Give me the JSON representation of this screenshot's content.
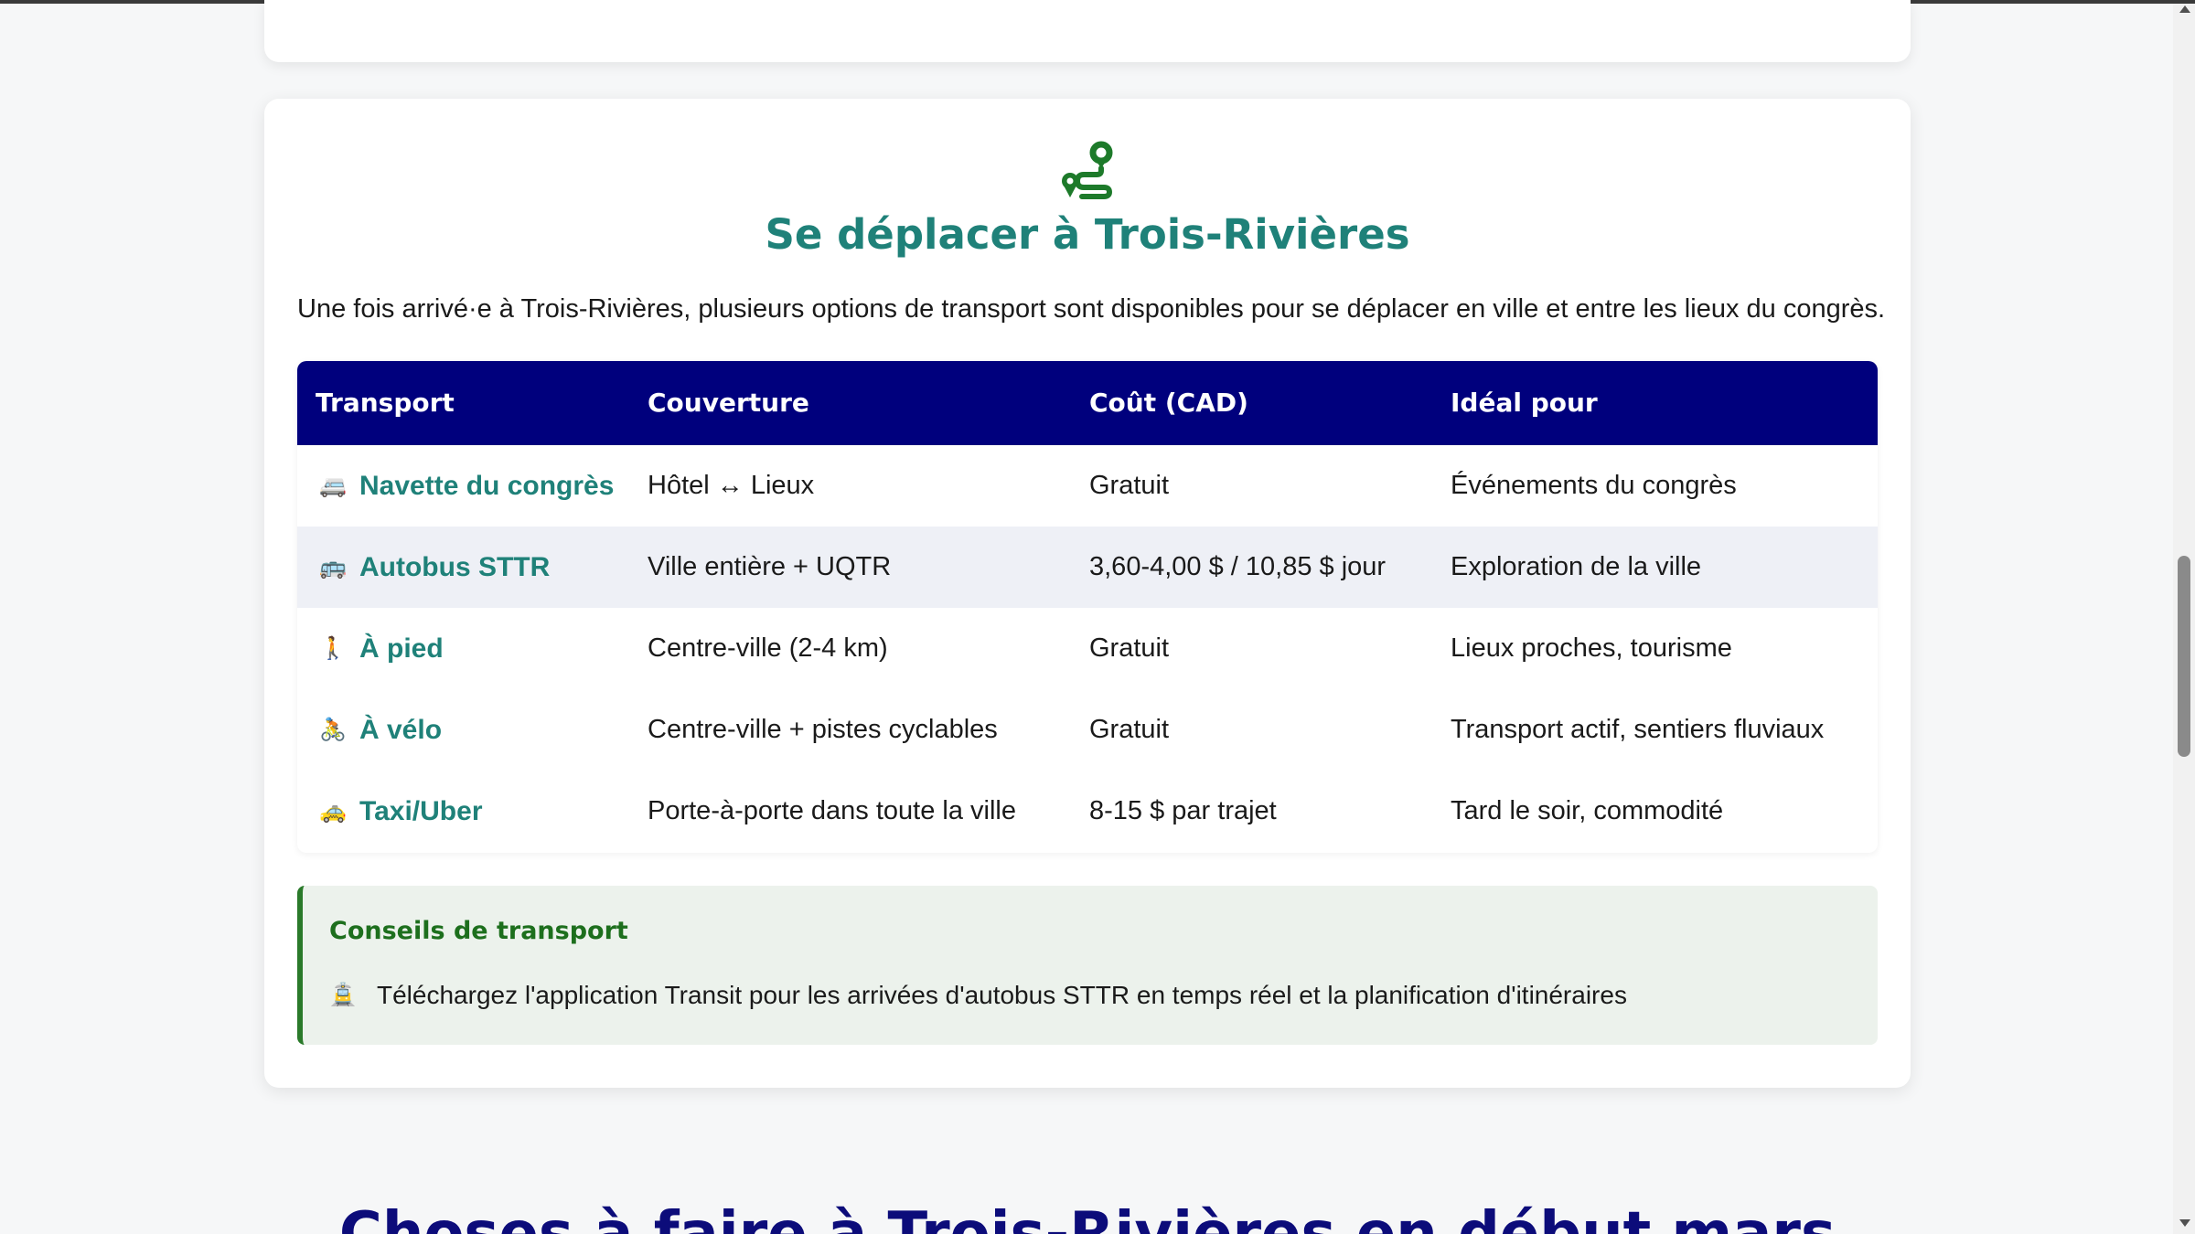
{
  "section": {
    "icon": "route-pin-icon",
    "title": "Se déplacer à Trois-Rivières",
    "intro": "Une fois arrivé·e à Trois-Rivières, plusieurs options de transport sont disponibles pour se déplacer en ville et entre les lieux du congrès."
  },
  "table": {
    "headers": [
      "Transport",
      "Couverture",
      "Coût (CAD)",
      "Idéal pour"
    ],
    "rows": [
      {
        "icon": "shuttle-van-icon",
        "glyph": "🚐",
        "mode": "Navette du congrès",
        "coverage": "Hôtel ↔ Lieux",
        "cost": "Gratuit",
        "ideal": "Événements du congrès"
      },
      {
        "icon": "bus-icon",
        "glyph": "🚌",
        "mode": "Autobus STTR",
        "coverage": "Ville entière + UQTR",
        "cost": "3,60-4,00 $ / 10,85 $ jour",
        "ideal": "Exploration de la ville"
      },
      {
        "icon": "walking-person-icon",
        "glyph": "🚶",
        "mode": "À pied",
        "coverage": "Centre-ville (2-4 km)",
        "cost": "Gratuit",
        "ideal": "Lieux proches, tourisme"
      },
      {
        "icon": "cyclist-icon",
        "glyph": "🚴",
        "mode": "À vélo",
        "coverage": "Centre-ville + pistes cyclables",
        "cost": "Gratuit",
        "ideal": "Transport actif, sentiers fluviaux"
      },
      {
        "icon": "taxi-icon",
        "glyph": "🚕",
        "mode": "Taxi/Uber",
        "coverage": "Porte-à-porte dans toute la ville",
        "cost": "8-15 $ par trajet",
        "ideal": "Tard le soir, commodité"
      }
    ]
  },
  "tips": {
    "title": "Conseils de transport",
    "items": [
      {
        "icon": "tram-icon",
        "glyph": "🚊",
        "text": "Téléchargez l'application Transit pour les arrivées d'autobus STTR en temps réel et la planification d'itinéraires"
      }
    ]
  },
  "next_section": {
    "title": "Choses à faire à Trois-Rivières en début mars"
  },
  "colors": {
    "accent_teal": "#1f8179",
    "header_navy": "#00007d",
    "tip_green": "#2a7a2a"
  }
}
